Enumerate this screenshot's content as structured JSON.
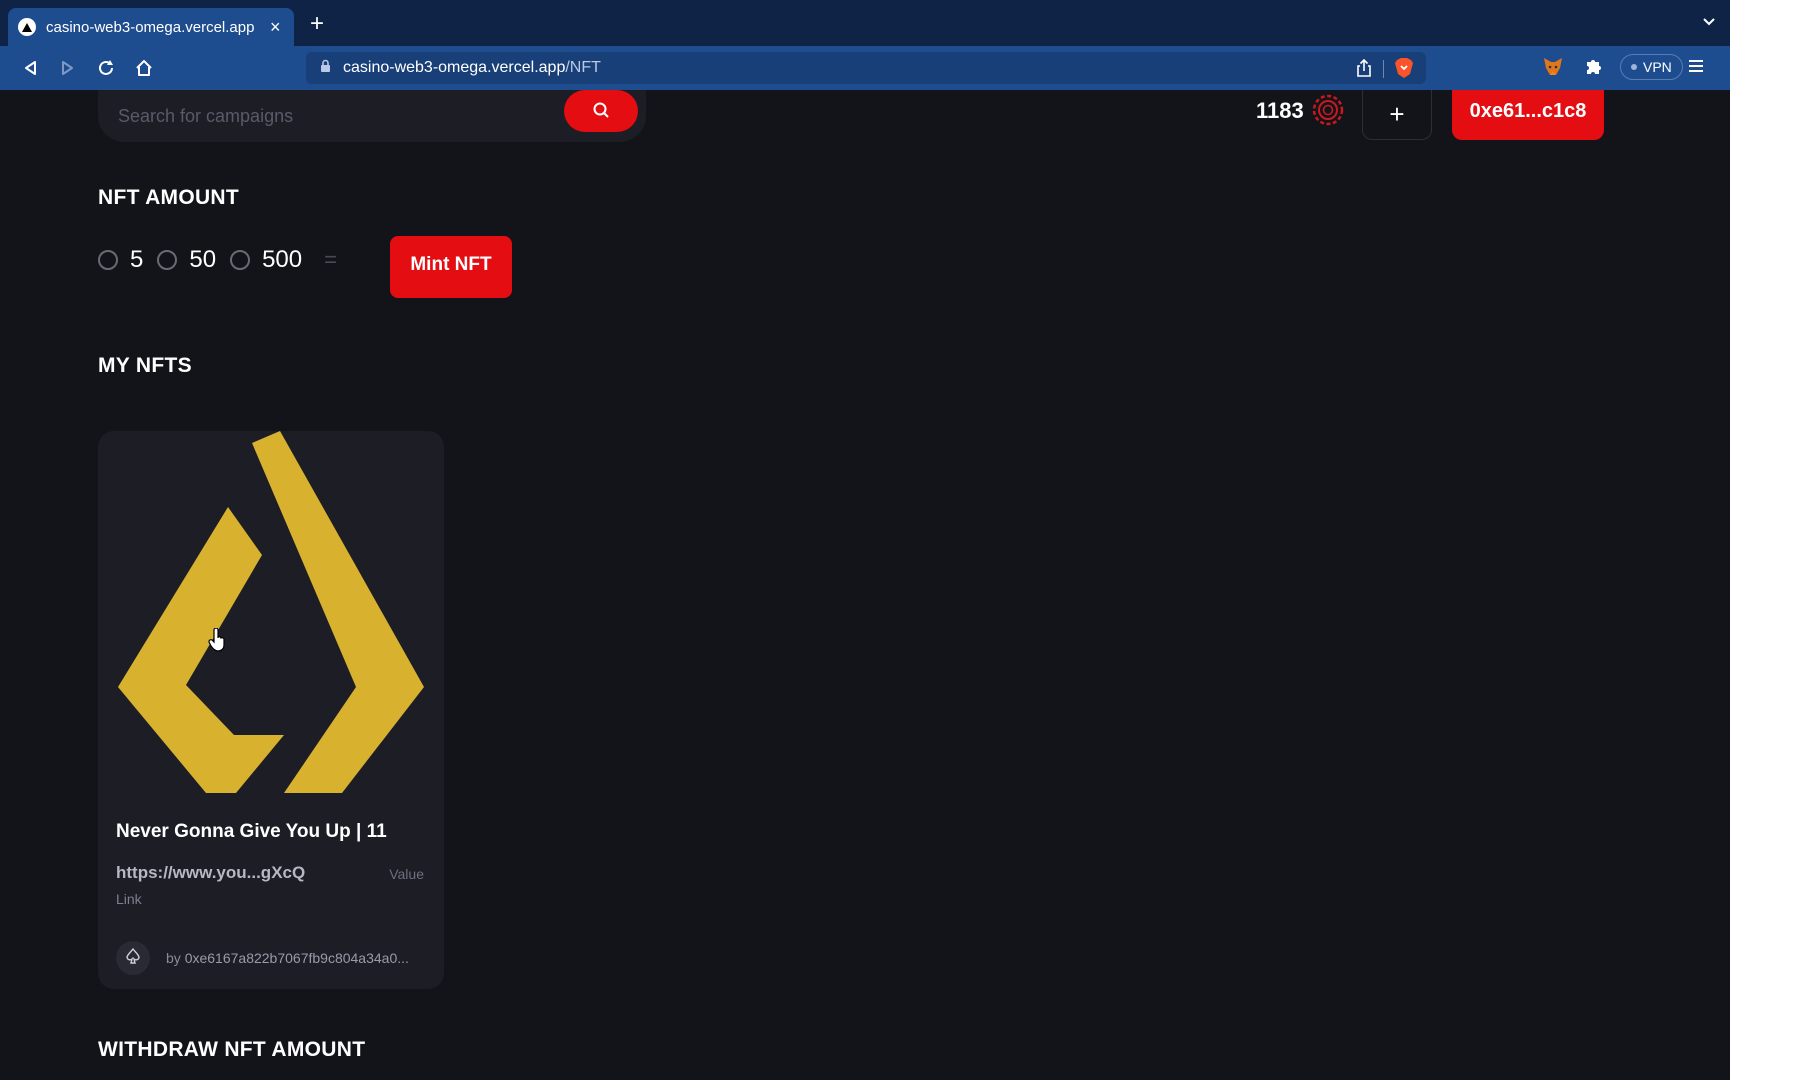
{
  "browser": {
    "tab_title": "casino-web3-omega.vercel.app",
    "tab_close": "×",
    "new_tab": "+",
    "url_host": "casino-web3-omega.vercel.app",
    "url_path": "/NFT",
    "vpn_label": "VPN"
  },
  "header": {
    "search_placeholder": "Search for campaigns",
    "balance": "1183",
    "add_label": "+",
    "wallet_label": "0xe61...c1c8"
  },
  "mint": {
    "title": "NFT AMOUNT",
    "options": [
      "5",
      "50",
      "500"
    ],
    "equals": "=",
    "button_label": "Mint NFT"
  },
  "my_nfts": {
    "title": "MY NFTS",
    "items": [
      {
        "name": "Never Gonna Give You Up | 11",
        "link": "https://www.you...gXcQ",
        "value_label": "Value",
        "link_label": "Link",
        "by_label": "by",
        "owner": "0xe6167a822b7067fb9c804a34a0..."
      }
    ]
  },
  "withdraw": {
    "title": "WITHDRAW NFT AMOUNT"
  },
  "colors": {
    "accent": "#e30d12",
    "background": "#13131a",
    "card": "#1d1d26",
    "nft_logo": "#d8b22f",
    "browser_chrome": "#1e4d8f"
  },
  "icons": {
    "tab_favicon": "vercel-triangle-icon",
    "back": "back-arrow-icon",
    "forward": "forward-arrow-icon",
    "reload": "reload-icon",
    "home": "home-icon",
    "lock": "lock-icon",
    "share": "share-icon",
    "brave": "brave-shield-icon",
    "metamask": "metamask-fox-icon",
    "extensions": "puzzle-icon",
    "menu": "hamburger-menu-icon",
    "search": "search-icon",
    "chip": "casino-chip-icon"
  }
}
